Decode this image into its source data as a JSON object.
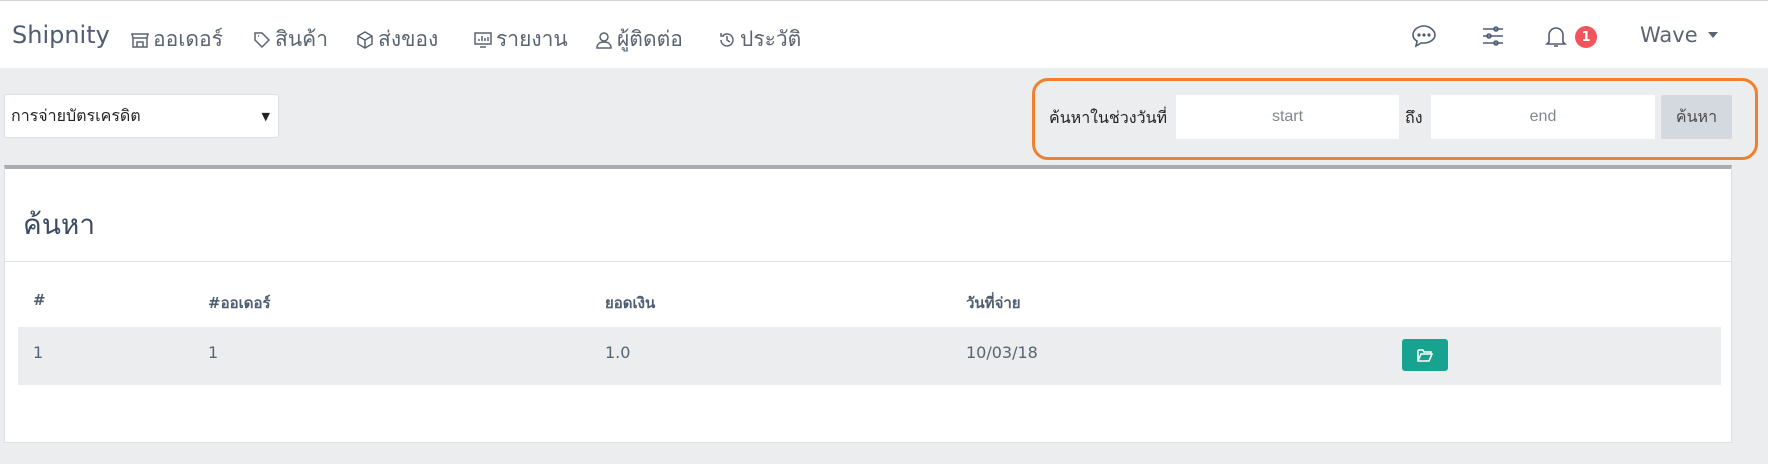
{
  "navbar": {
    "brand": "Shipnity",
    "items": [
      {
        "label": "ออเดอร์",
        "icon": "store-icon"
      },
      {
        "label": "สินค้า",
        "icon": "tags-icon"
      },
      {
        "label": "ส่งของ",
        "icon": "box-icon"
      },
      {
        "label": "รายงาน",
        "icon": "chart-icon"
      },
      {
        "label": "ผู้ติดต่อ",
        "icon": "user-icon"
      },
      {
        "label": "ประวัติ",
        "icon": "history-icon"
      }
    ],
    "notification_count": "1",
    "user": "Wave"
  },
  "filter": {
    "selected": "การจ่ายบัตรเครดิต"
  },
  "date_search": {
    "label": "ค้นหาในช่วงวันที่",
    "start_placeholder": "start",
    "to_label": "ถึง",
    "end_placeholder": "end",
    "button": "ค้นหา"
  },
  "card": {
    "title": "ค้นหา",
    "columns": [
      "#",
      "#ออเดอร์",
      "ยอดเงิน",
      "วันที่จ่าย"
    ],
    "rows": [
      {
        "no": "1",
        "order": "1",
        "amount": "1.0",
        "date": "10/03/18"
      }
    ]
  },
  "colors": {
    "highlight": "#f0802c",
    "action_button": "#17a38f",
    "badge": "#f2545b"
  }
}
